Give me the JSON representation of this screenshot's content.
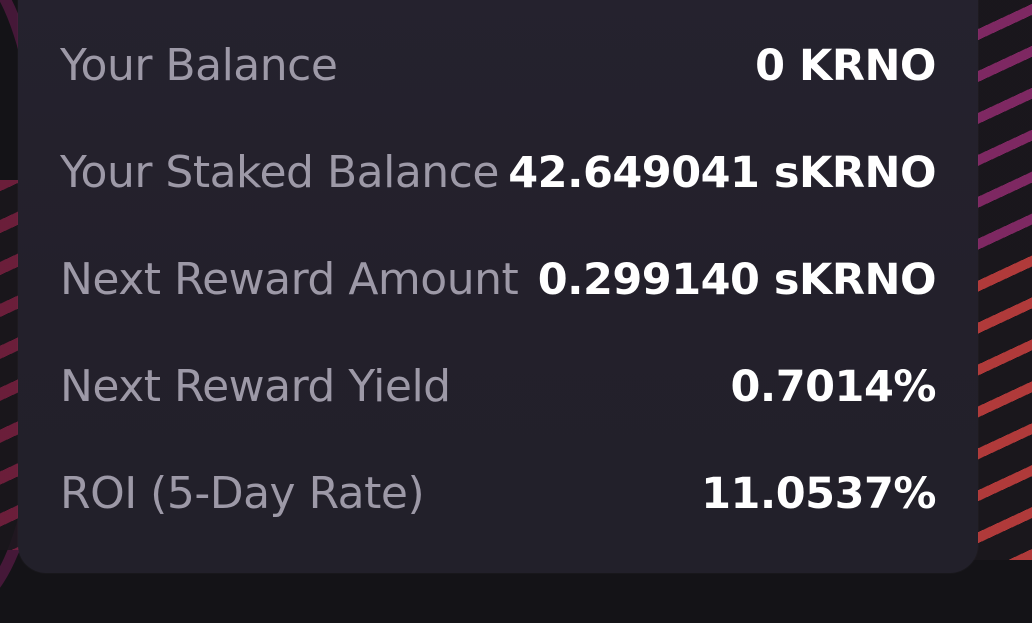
{
  "stats": [
    {
      "label": "Your Balance",
      "value": "0 KRNO"
    },
    {
      "label": "Your Staked Balance",
      "value": "42.649041 sKRNO"
    },
    {
      "label": "Next Reward Amount",
      "value": "0.299140 sKRNO"
    },
    {
      "label": "Next Reward Yield",
      "value": "0.7014%"
    },
    {
      "label": "ROI (5-Day Rate)",
      "value": "11.0537%"
    }
  ],
  "colors": {
    "background": "#141317",
    "card": "#24212c",
    "label": "#9d99a7",
    "value": "#ffffff",
    "accent_purple": "#8a2a6a",
    "accent_orange": "#c0402c"
  }
}
